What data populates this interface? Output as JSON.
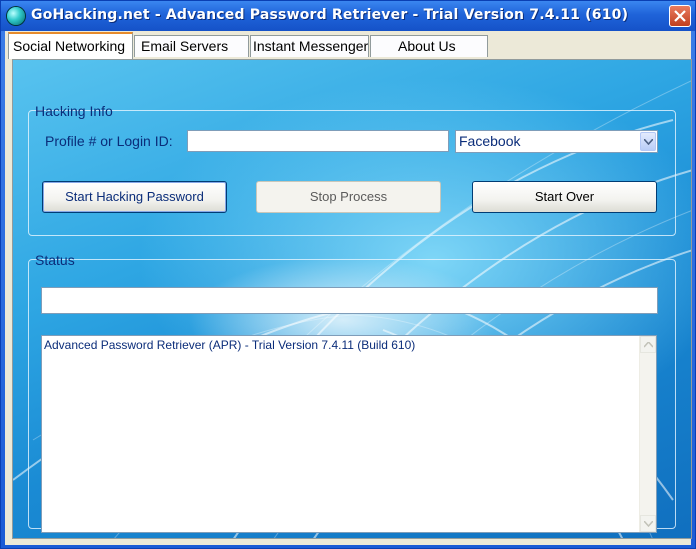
{
  "window": {
    "title": "GoHacking.net - Advanced Password Retriever - Trial Version 7.4.11 (610)",
    "title_icon": "globe-icon",
    "close_icon": "close-icon"
  },
  "tabs": [
    {
      "label": "Social Networking",
      "active": true
    },
    {
      "label": "Email Servers",
      "active": false
    },
    {
      "label": "Instant Messengers",
      "active": false
    },
    {
      "label": "About Us",
      "active": false
    }
  ],
  "hacking_info": {
    "group_label": "Hacking Info",
    "profile_label": "Profile # or Login ID:",
    "profile_value": "",
    "network_select": {
      "selected": "Facebook"
    },
    "buttons": {
      "start": "Start Hacking Password",
      "stop": "Stop Process",
      "start_over": "Start Over"
    }
  },
  "status": {
    "group_label": "Status",
    "status_value": "",
    "log_lines": [
      "Advanced Password Retriever (APR) - Trial Version 7.4.11 (Build 610)"
    ]
  },
  "colors": {
    "accent_text": "#0b2d7a",
    "titlebar": "#1f63d9",
    "panel_blue": "#2ea6e3",
    "active_tab_highlight": "#e68b2c"
  }
}
